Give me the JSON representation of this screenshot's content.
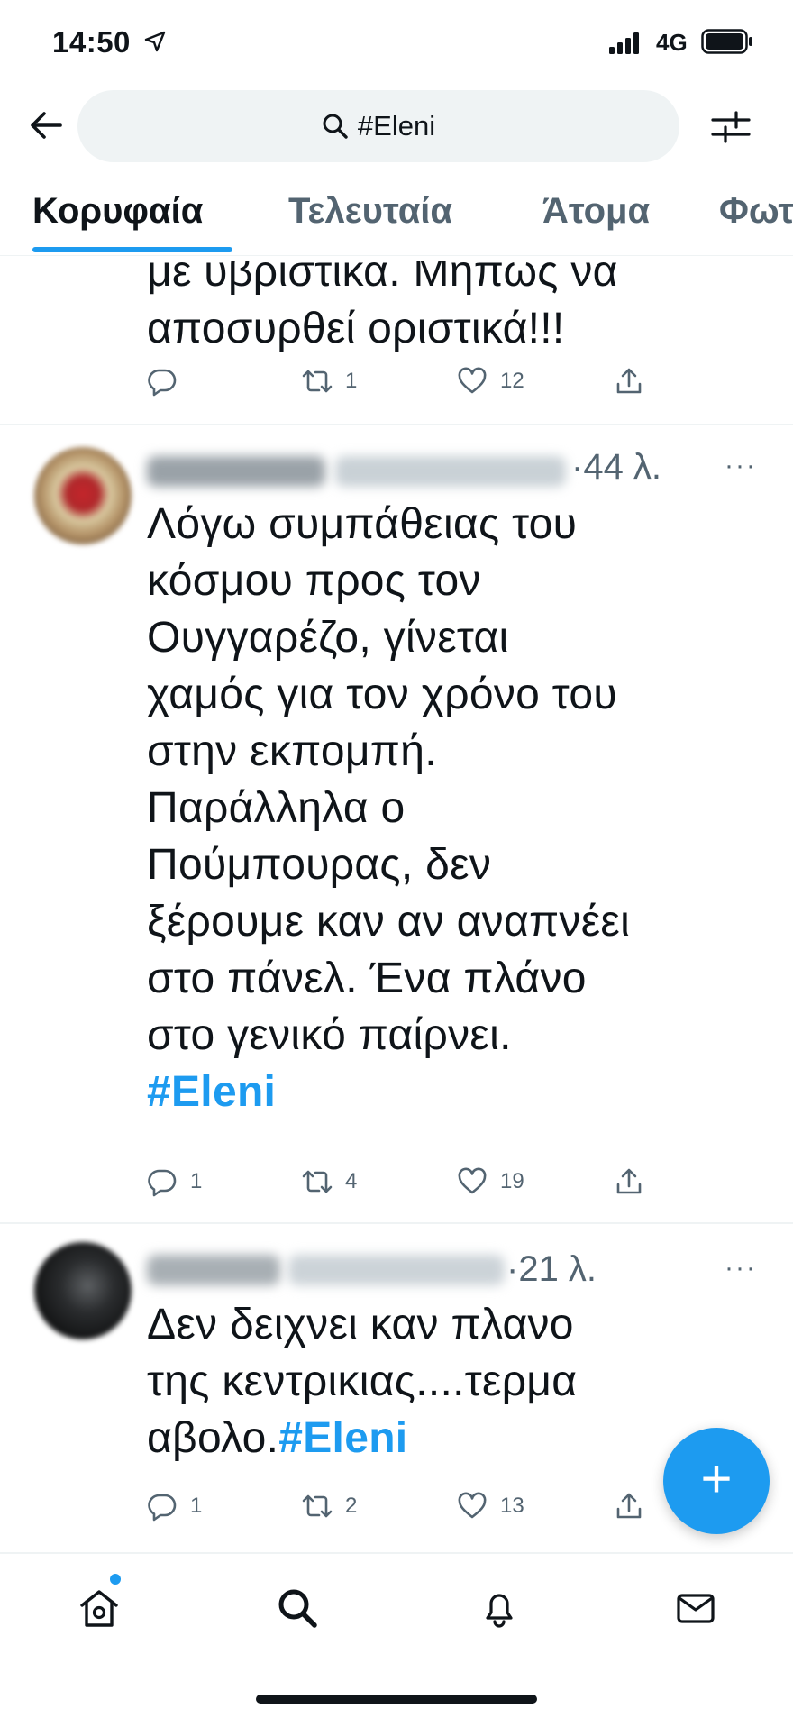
{
  "status_bar": {
    "time": "14:50",
    "network": "4G"
  },
  "search": {
    "query": "#Eleni"
  },
  "tabs": [
    {
      "label": "Κορυφαία",
      "active": true
    },
    {
      "label": "Τελευταία",
      "active": false
    },
    {
      "label": "Άτομα",
      "active": false
    },
    {
      "label": "Φωτ",
      "active": false
    }
  ],
  "tweets": [
    {
      "text_lines": [
        "με υβριστικά. Μήπως να",
        "αποσυρθεί οριστικά!!!"
      ],
      "replies": "",
      "retweets": "1",
      "likes": "12"
    },
    {
      "time": "·44 λ.",
      "text_lines": [
        "Λόγω συμπάθειας του",
        "κόσμου προς τον",
        "Ουγγαρέζο, γίνεται",
        "χαμός για τον χρόνο του",
        "στην εκπομπή.",
        "Παράλληλα ο",
        "Πούμπουρας, δεν",
        "ξέρουμε καν αν αναπνέει",
        "στο πάνελ. Ένα πλάνο",
        "στο γενικό παίρνει."
      ],
      "hashtag": "#Eleni",
      "replies": "1",
      "retweets": "4",
      "likes": "19"
    },
    {
      "time": "·21 λ.",
      "text_lines": [
        "Δεν δειχνει καν πλανο",
        "της κεντρικιας....τερμα"
      ],
      "last_line_prefix": "αβολο.",
      "hashtag": "#Eleni",
      "replies": "1",
      "retweets": "2",
      "likes": "13"
    }
  ],
  "fab": {
    "label": "+"
  },
  "colors": {
    "accent": "#1d9bf0",
    "text": "#0f1419",
    "muted": "#536471"
  }
}
